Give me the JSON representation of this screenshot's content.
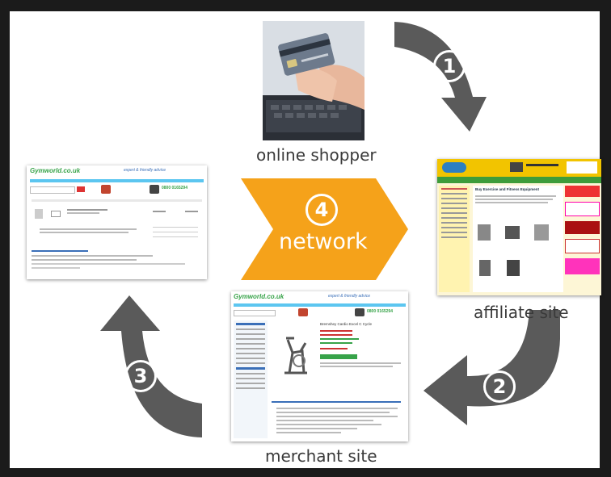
{
  "steps": [
    {
      "number": "1",
      "label": "online shopper"
    },
    {
      "number": "2",
      "label": "affiliate site"
    },
    {
      "number": "3",
      "label": "merchant site"
    },
    {
      "number": "4",
      "label": "network"
    }
  ],
  "shots": {
    "gymworld_logo": "Gymworld.co.uk",
    "gymworld_tagline": "expert & friendly advice",
    "gymworld_phone": "0800 0165294",
    "merchant_product_title": "Bremshey Cardio Excel C Cycle",
    "affiliate_heading": "Buy Exercise and Fitness Equipment"
  },
  "colors": {
    "arrow_gray": "#5a5a5a",
    "network_orange": "#f5a21a",
    "gymworld_green": "#37a349",
    "affiliate_header": "#f2c400"
  }
}
